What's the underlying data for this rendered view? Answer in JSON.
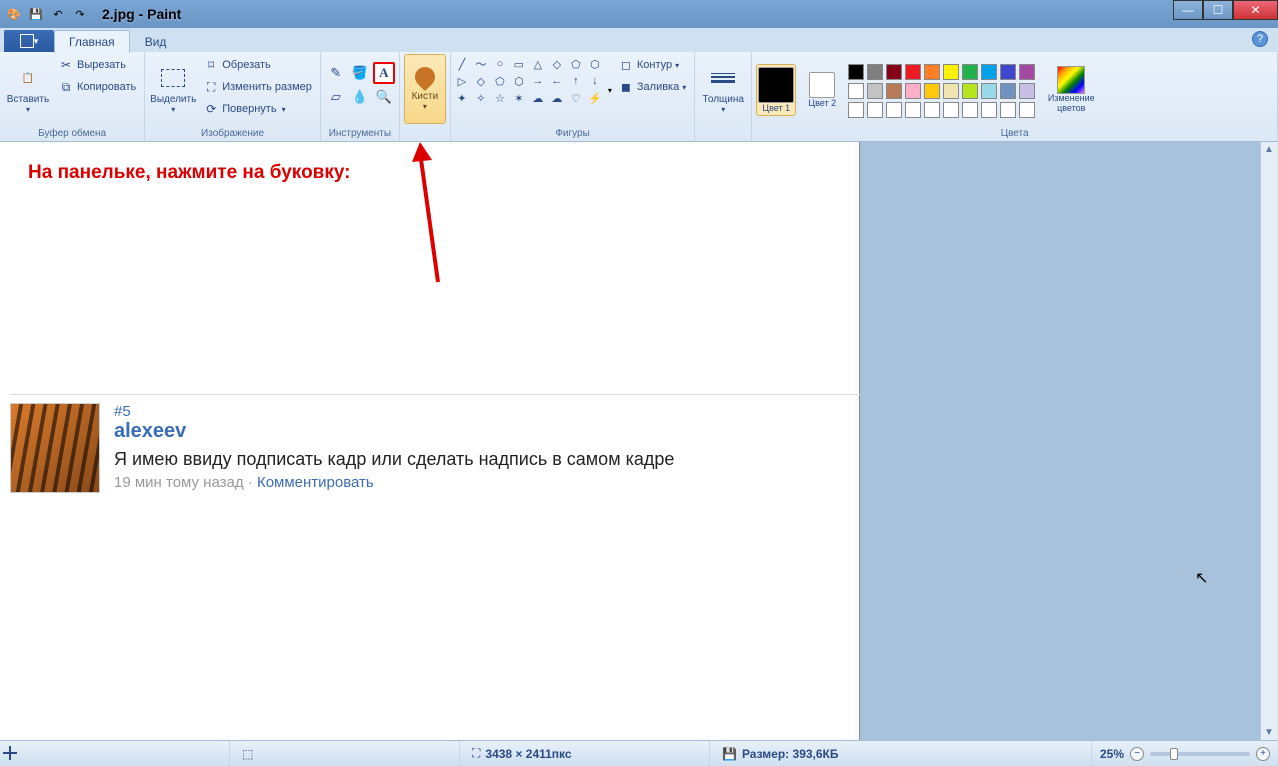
{
  "title": "2.jpg - Paint",
  "tabs": {
    "main": "Главная",
    "view": "Вид"
  },
  "ribbon": {
    "clipboard": {
      "paste": "Вставить",
      "cut": "Вырезать",
      "copy": "Копировать",
      "label": "Буфер обмена"
    },
    "image": {
      "select": "Выделить",
      "crop": "Обрезать",
      "resize": "Изменить размер",
      "rotate": "Повернуть",
      "label": "Изображение"
    },
    "tools": {
      "label": "Инструменты"
    },
    "brushes": {
      "label": "Кисти"
    },
    "shapes": {
      "outline": "Контур",
      "fill": "Заливка",
      "label": "Фигуры"
    },
    "thickness": {
      "label": "Толщина"
    },
    "colors": {
      "c1": "Цвет 1",
      "c2": "Цвет 2",
      "edit": "Изменение цветов",
      "label": "Цвета"
    }
  },
  "palette_row1": [
    "#000000",
    "#7f7f7f",
    "#880015",
    "#ed1c24",
    "#ff7f27",
    "#fff200",
    "#22b14c",
    "#00a2e8",
    "#3f48cc",
    "#a349a4"
  ],
  "palette_row2": [
    "#ffffff",
    "#c3c3c3",
    "#b97a57",
    "#ffaec9",
    "#ffc90e",
    "#efe4b0",
    "#b5e61d",
    "#99d9ea",
    "#7092be",
    "#c8bfe7"
  ],
  "canvas": {
    "annotation": "На панельке, нажмите на буковку:",
    "post": {
      "num": "#5",
      "author": "alexeev",
      "text": "Я имею ввиду подписать кадр или сделать надпись в самом кадре",
      "meta_time": "19 мин тому назад",
      "meta_sep": " · ",
      "meta_action": "Комментировать"
    }
  },
  "status": {
    "dimensions": "3438 × 2411пкс",
    "size_label": "Размер:",
    "size_value": "393,6КБ",
    "zoom": "25%"
  }
}
